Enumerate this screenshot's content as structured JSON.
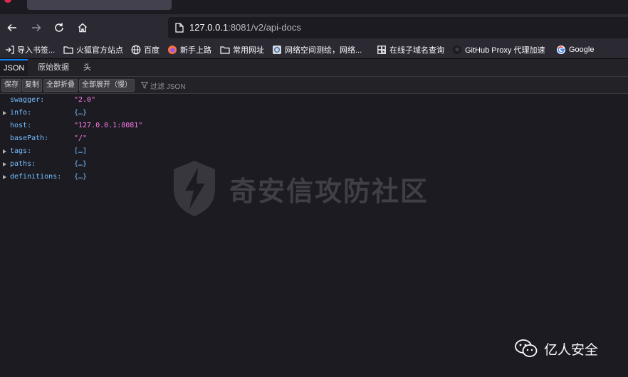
{
  "browser": {
    "url_host": "127.0.0.1",
    "url_rest": ":8081/v2/api-docs",
    "bookmarks": [
      {
        "label": "导入书签...",
        "icon": "import-icon"
      },
      {
        "label": "火狐官方站点",
        "icon": "folder-icon"
      },
      {
        "label": "百度",
        "icon": "globe-icon"
      },
      {
        "label": "新手上路",
        "icon": "firefox-icon"
      },
      {
        "label": "常用网址",
        "icon": "folder-icon"
      },
      {
        "label": "网络空间测绘，网络...",
        "icon": "site-icon"
      },
      {
        "label": "在线子域名查询",
        "icon": "qr-icon"
      },
      {
        "label": "GitHub Proxy 代理加速",
        "icon": "github-icon"
      },
      {
        "label": "Google",
        "icon": "google-icon"
      }
    ]
  },
  "viewer": {
    "tabs": [
      "JSON",
      "原始数据",
      "头"
    ],
    "active_tab": "JSON",
    "toolbar": {
      "save": "保存",
      "copy": "复制",
      "collapse_all": "全部折叠",
      "expand_all": "全部展开（慢）",
      "filter_placeholder": "过滤 JSON"
    },
    "rows": [
      {
        "key": "swagger:",
        "value": "\"2.0\"",
        "kind": "string",
        "expandable": false
      },
      {
        "key": "info:",
        "value": "{…}",
        "kind": "object",
        "expandable": true
      },
      {
        "key": "host:",
        "value": "\"127.0.0.1:8081\"",
        "kind": "string",
        "expandable": false
      },
      {
        "key": "basePath:",
        "value": "\"/\"",
        "kind": "string",
        "expandable": false
      },
      {
        "key": "tags:",
        "value": "[…]",
        "kind": "object",
        "expandable": true
      },
      {
        "key": "paths:",
        "value": "{…}",
        "kind": "object",
        "expandable": true
      },
      {
        "key": "definitions:",
        "value": "{…}",
        "kind": "object",
        "expandable": true
      }
    ]
  },
  "watermark": {
    "text": "奇安信攻防社区"
  },
  "brand": {
    "text": "亿人安全"
  },
  "colors": {
    "key": "#75bfff",
    "string": "#ff7de9",
    "accent": "#0a84ff"
  }
}
